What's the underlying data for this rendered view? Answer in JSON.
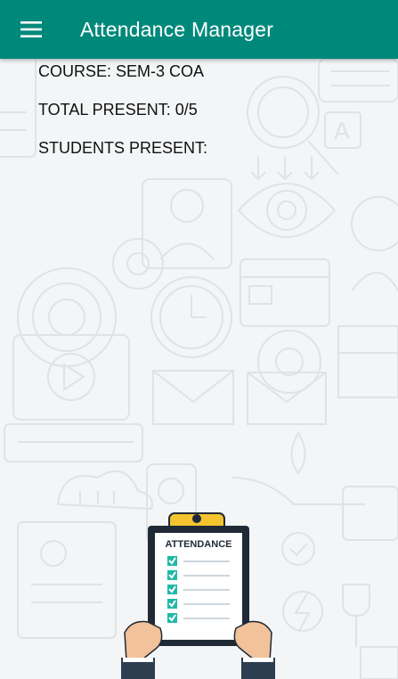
{
  "app_bar": {
    "title": "Attendance Manager",
    "menu_icon": "hamburger-menu-icon",
    "color": "#00897b"
  },
  "details": {
    "course": "COURSE: SEM-3 COA",
    "total_present": "TOTAL PRESENT: 0/5",
    "students_present": "STUDENTS PRESENT:"
  },
  "illustration": {
    "clipboard_title": "ATTENDANCE",
    "checked_rows": 5
  }
}
